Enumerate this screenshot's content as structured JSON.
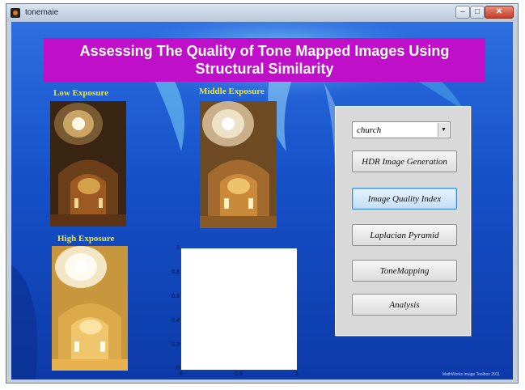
{
  "window": {
    "title": "tonemaie"
  },
  "banner": {
    "title": "Assessing The Quality of Tone Mapped Images Using Structural Similarity"
  },
  "images": {
    "low_label": "Low Exposure",
    "middle_label": "Middle Exposure",
    "high_label": "High Exposure"
  },
  "axes": {
    "y_ticks": [
      "1",
      "0.8",
      "0.6",
      "0.4",
      "0.2",
      "0"
    ],
    "x_ticks": [
      "0",
      "0.5",
      "1"
    ]
  },
  "controls": {
    "dropdown_value": "church",
    "buttons": [
      {
        "label": "HDR Image Generation",
        "active": false
      },
      {
        "label": "Image Quality Index",
        "active": true
      },
      {
        "label": "Laplacian Pyramid",
        "active": false
      },
      {
        "label": "ToneMapping",
        "active": false
      },
      {
        "label": "Analysis",
        "active": false
      }
    ]
  },
  "footer": {
    "text": "MathWorks Image Toolbox 2011"
  },
  "colors": {
    "banner": "#c00fc8",
    "label": "#f4e81f",
    "background": "#1550c8"
  }
}
